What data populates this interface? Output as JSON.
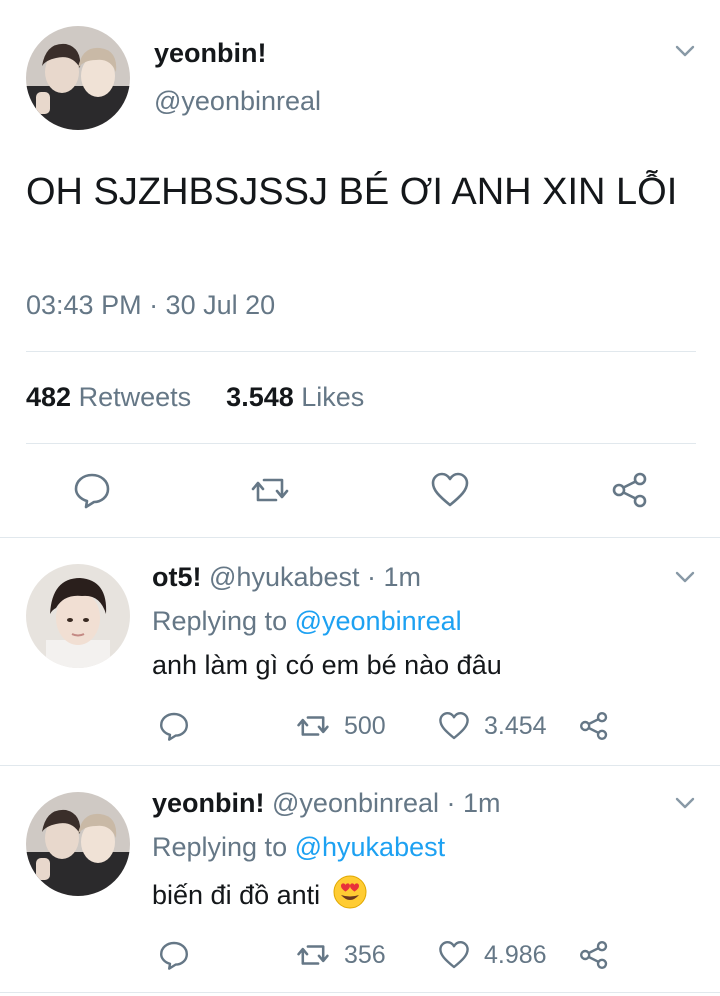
{
  "main_tweet": {
    "name": "yeonbin!",
    "handle": "@yeonbinreal",
    "text": "OH SJZHBSJSSJ BÉ ƠI ANH XIN LỖI",
    "timestamp": "03:43 PM · 30 Jul 20",
    "retweets_count": "482",
    "retweets_label": "Retweets",
    "likes_count": "3.548",
    "likes_label": "Likes",
    "avatar_icon": "two-people-avatar"
  },
  "replies": [
    {
      "name": "ot5!",
      "handle_time": "@hyukabest · 1m",
      "replying_label": "Replying to",
      "replying_to": "@yeonbinreal",
      "text": "anh làm gì có em bé nào đâu",
      "retweets": "500",
      "likes": "3.454",
      "avatar_icon": "person-avatar"
    },
    {
      "name": "yeonbin!",
      "handle_time": "@yeonbinreal · 1m",
      "replying_label": "Replying to",
      "replying_to": "@hyukabest",
      "text": "biến đi đồ anti",
      "emoji": "heart-eyes-emoji",
      "retweets": "356",
      "likes": "4.986",
      "avatar_icon": "two-people-avatar"
    }
  ],
  "colors": {
    "text": "#14171a",
    "secondary": "#657786",
    "link": "#1da1f2",
    "divider": "#e1e8ed"
  }
}
